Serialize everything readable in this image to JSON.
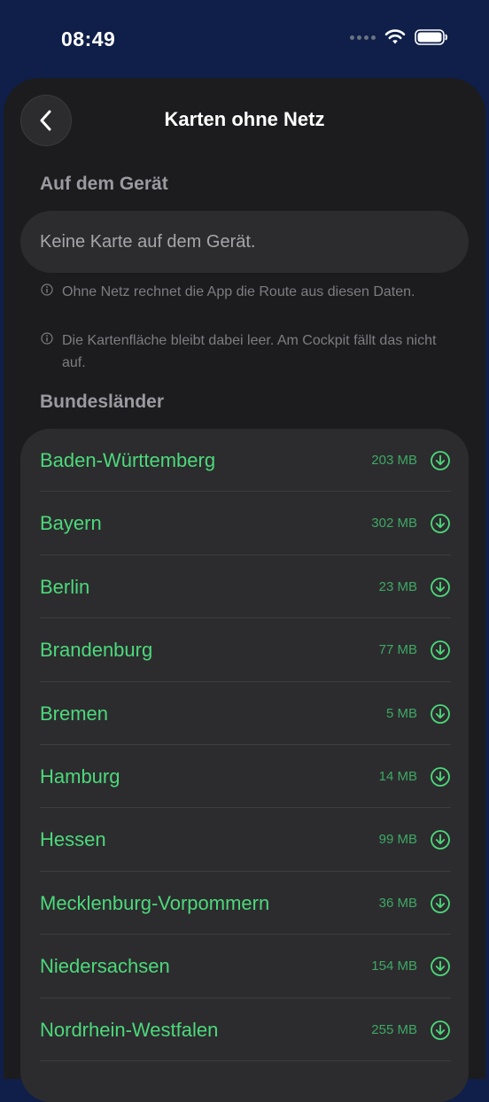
{
  "status_bar": {
    "time": "08:49"
  },
  "nav": {
    "title": "Karten ohne Netz"
  },
  "device": {
    "header": "Auf dem Gerät",
    "empty_text": "Keine Karte auf dem Gerät."
  },
  "info": [
    "Ohne Netz rechnet die App die Route aus diesen Daten.",
    "Die Kartenfläche bleibt dabei leer. Am Cockpit fällt das nicht auf."
  ],
  "regions": {
    "header": "Bundesländer",
    "items": [
      {
        "name": "Baden-Württemberg",
        "size": "203 MB"
      },
      {
        "name": "Bayern",
        "size": "302 MB"
      },
      {
        "name": "Berlin",
        "size": "23 MB"
      },
      {
        "name": "Brandenburg",
        "size": "77 MB"
      },
      {
        "name": "Bremen",
        "size": "5 MB"
      },
      {
        "name": "Hamburg",
        "size": "14 MB"
      },
      {
        "name": "Hessen",
        "size": "99 MB"
      },
      {
        "name": "Mecklenburg-Vorpommern",
        "size": "36 MB"
      },
      {
        "name": "Niedersachsen",
        "size": "154 MB"
      },
      {
        "name": "Nordrhein-Westfalen",
        "size": "255 MB"
      },
      {
        "name": "",
        "size": ""
      }
    ]
  },
  "colors": {
    "accent": "#4cd97b",
    "sheet": "#1c1c1e",
    "card": "#2c2c2e",
    "backdrop": "#0f1f4a"
  },
  "icons": {
    "back": "chevron-left-icon",
    "info": "info-circle-icon",
    "download": "download-circle-icon"
  }
}
